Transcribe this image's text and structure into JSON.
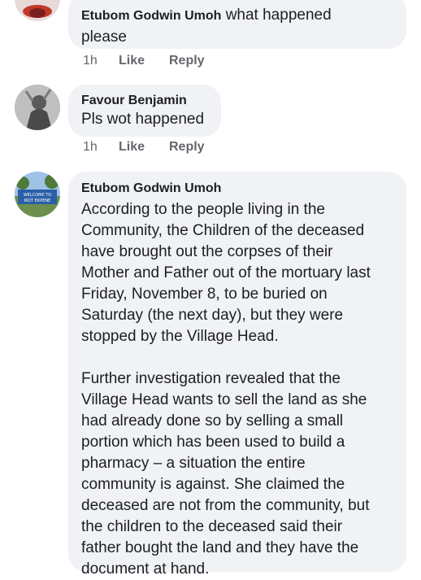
{
  "comments": [
    {
      "author": "Etubom Godwin Umoh",
      "text_inline": "what happened",
      "text_line2": "please",
      "time": "1h",
      "like": "Like",
      "reply": "Reply"
    },
    {
      "author": "Favour Benjamin",
      "text": "Pls wot happened",
      "time": "1h",
      "like": "Like",
      "reply": "Reply"
    },
    {
      "author": "Etubom Godwin Umoh",
      "avatar_sign_line1": "WELCOME TO",
      "avatar_sign_line2": "IKOT EKPENE",
      "paragraph1": [
        "According to the people living in the",
        "Community, the Children of the deceased",
        "have brought out the corpses of their",
        "Mother and Father out of the mortuary last",
        "Friday, November 8, to be buried on",
        "Saturday (the next day), but they were",
        "stopped by the Village Head."
      ],
      "paragraph2": [
        "Further investigation revealed that the",
        "Village Head wants to sell the land as she",
        "had already done so by selling a small",
        "portion which has been used to build a",
        "pharmacy – a situation the entire",
        "community is against. She claimed the",
        "deceased are not from the community, but",
        "the children to the deceased said their",
        "father bought the land and they have the",
        "document at hand."
      ]
    }
  ]
}
